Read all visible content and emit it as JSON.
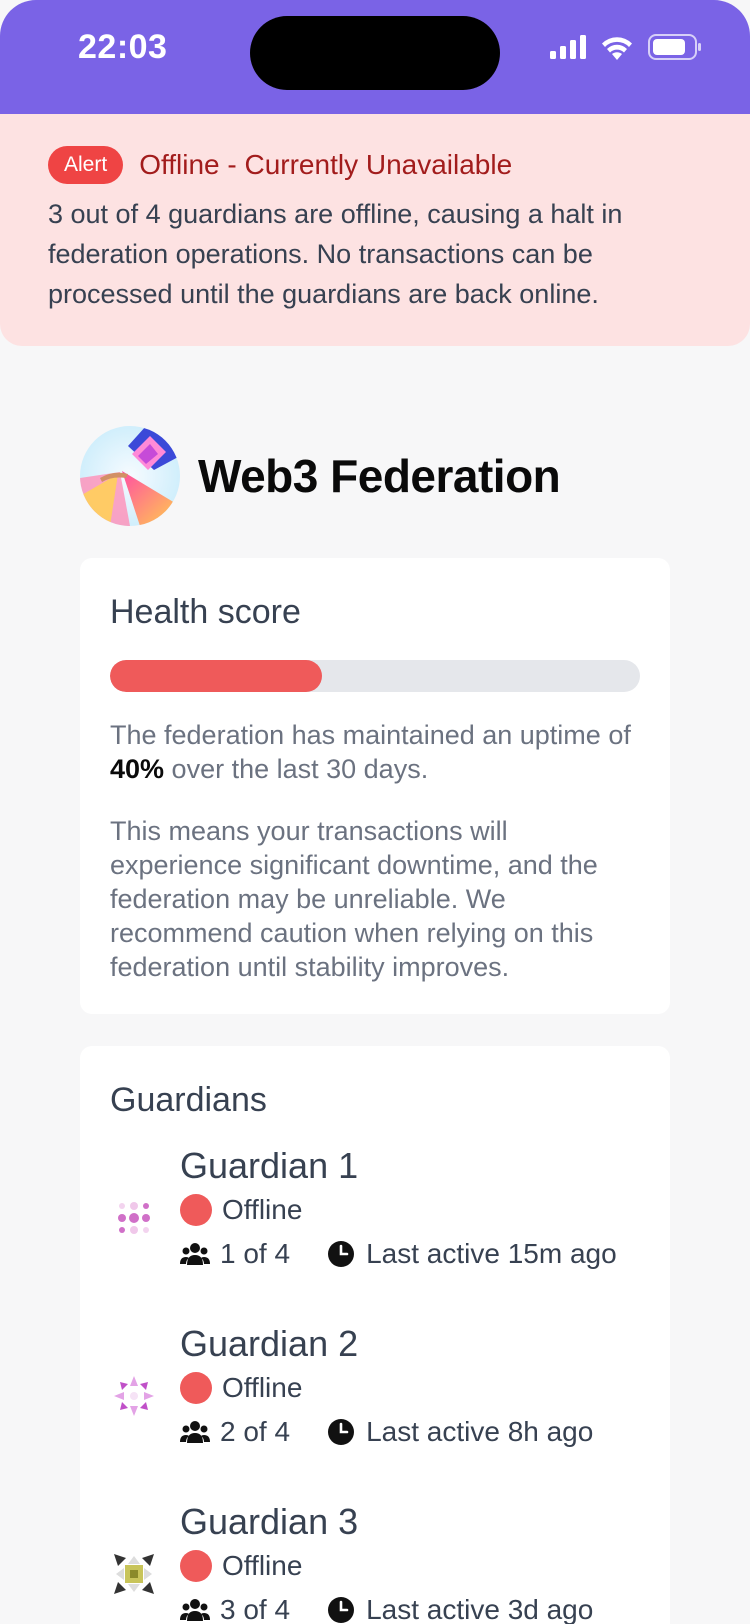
{
  "status_bar": {
    "time": "22:03"
  },
  "alert": {
    "badge": "Alert",
    "title": "Offline - Currently Unavailable",
    "body": "3 out of 4 guardians are offline, causing a halt in federation operations. No transactions can be processed until the guardians are back online."
  },
  "federation": {
    "name": "Web3 Federation"
  },
  "health": {
    "title": "Health score",
    "uptime_percent": 40,
    "uptime_prefix": "The federation has maintained an uptime of ",
    "uptime_value": "40%",
    "uptime_suffix": " over the last 30 days.",
    "explanation": "This means your transactions will experience significant downtime, and the federation may be unreliable. We recommend caution when relying on this federation until stability improves.",
    "bar_color": "#ef5a5a"
  },
  "guardians": {
    "title": "Guardians",
    "items": [
      {
        "name": "Guardian 1",
        "status": "Offline",
        "position": "1 of 4",
        "last_active": "Last active 15m ago"
      },
      {
        "name": "Guardian 2",
        "status": "Offline",
        "position": "2 of 4",
        "last_active": "Last active 8h ago"
      },
      {
        "name": "Guardian 3",
        "status": "Offline",
        "position": "3 of 4",
        "last_active": "Last active 3d ago"
      }
    ]
  },
  "icons": [
    "signal-icon",
    "wifi-icon",
    "battery-icon",
    "users-icon",
    "clock-icon"
  ],
  "colors": {
    "accent": "#7a63e6",
    "alert_bg": "#fde2e2",
    "alert_badge": "#ef4444",
    "offline": "#ef5a5a"
  }
}
